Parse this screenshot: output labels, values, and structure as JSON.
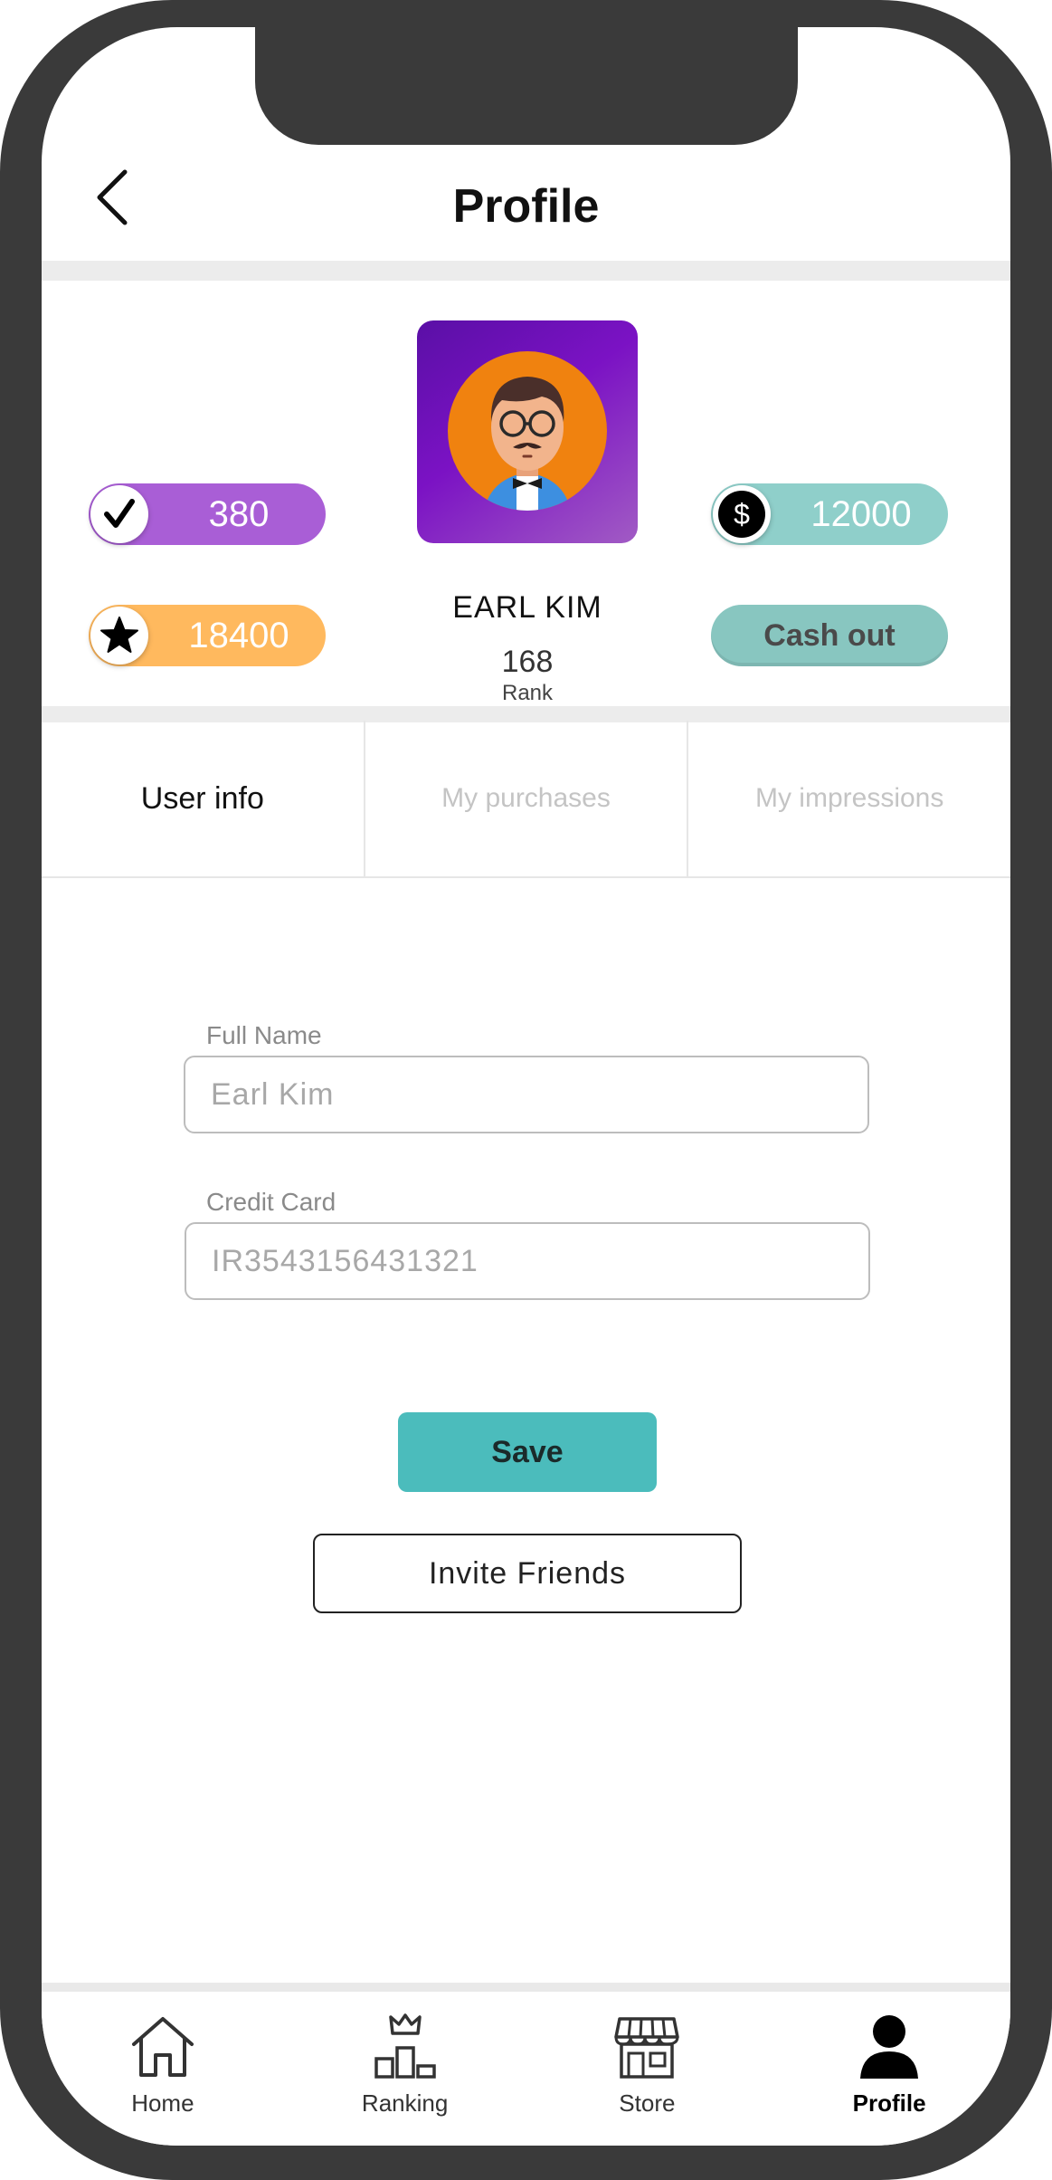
{
  "header": {
    "title": "Profile"
  },
  "profile": {
    "name": "EARL KIM",
    "rank_value": "168",
    "rank_label": "Rank"
  },
  "stats": {
    "checks": "380",
    "stars": "18400",
    "coins": "12000",
    "cashout_label": "Cash out"
  },
  "tabs": [
    {
      "label": "User info",
      "active": true
    },
    {
      "label": "My purchases",
      "active": false
    },
    {
      "label": "My impressions",
      "active": false
    }
  ],
  "form": {
    "full_name_label": "Full Name",
    "full_name_placeholder": "Earl Kim",
    "credit_card_label": "Credit Card",
    "credit_card_placeholder": "IR3543156431321"
  },
  "actions": {
    "save_label": "Save",
    "invite_label": "Invite Friends"
  },
  "nav": [
    {
      "label": "Home",
      "icon": "home-icon"
    },
    {
      "label": "Ranking",
      "icon": "ranking-icon"
    },
    {
      "label": "Store",
      "icon": "store-icon"
    },
    {
      "label": "Profile",
      "icon": "profile-icon",
      "active": true
    }
  ],
  "colors": {
    "frame": "#3a3a3a",
    "checks_pill": "#a95ed6",
    "stars_pill": "#ffb95e",
    "coins_pill": "#8fcfca",
    "cashout_pill": "#88c6c0",
    "save_button": "#4bbcbc",
    "avatar_bg": "#7b12c4"
  }
}
